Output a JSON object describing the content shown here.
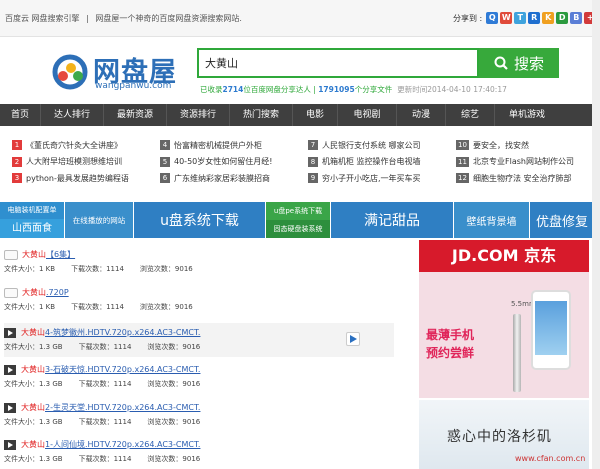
{
  "topbar": {
    "links": [
      "百度云 网盘搜索引擎",
      "|",
      "网盘屋一个神奇的百度网盘资源搜索网站."
    ],
    "share_label": "分享到 :"
  },
  "logo": {
    "cn": "网盘屋",
    "en": "wangpanwu.com"
  },
  "search": {
    "value": "大黄山",
    "button": "搜索"
  },
  "stats": {
    "prefix": "已收录",
    "users": "2714",
    "mid": "位百度网盘分享达人 |",
    "files": "1791095",
    "suffix": "个分享文件",
    "updated": "更新时间2014-04-10 17:40:17"
  },
  "nav": [
    "首页",
    "达人排行",
    "最新资源",
    "资源排行",
    "热门搜索",
    "电影",
    "电视剧",
    "动漫",
    "综艺",
    "单机游戏"
  ],
  "hot": [
    [
      {
        "n": "1",
        "t": "《董氏奇穴针灸大全讲座》"
      },
      {
        "n": "2",
        "t": "人大附早培班模测想维培训"
      },
      {
        "n": "3",
        "t": "python-最具发展趋势编程语"
      }
    ],
    [
      {
        "n": "4",
        "t": "怡富精密机械提供户外柜"
      },
      {
        "n": "5",
        "t": "40-50岁女性如何留住月经!"
      },
      {
        "n": "6",
        "t": "广东维纳彩家居彩装膜招商"
      }
    ],
    [
      {
        "n": "7",
        "t": "人民银行支付系统 哪家公司"
      },
      {
        "n": "8",
        "t": "机箱机柜 监控操作台电视墙"
      },
      {
        "n": "9",
        "t": "穷小子开小吃店,一年买车买"
      }
    ],
    [
      {
        "n": "10",
        "t": "要安全，找安然"
      },
      {
        "n": "11",
        "t": "北京专业Flash网站制作公司"
      },
      {
        "n": "12",
        "t": "细胞生物疗法 安全治疗肺部"
      }
    ]
  ],
  "banners": {
    "b1a": "电脑装机配置单",
    "b1b": "山西面食",
    "b2": "在线播放的网站",
    "b3": "u盘系统下载",
    "b4a": "u盘pe系统下载",
    "b4b": "固态硬盘装系统",
    "b5": "满记甜品",
    "b6": "壁纸背景墙",
    "b7": "优盘修复"
  },
  "results": [
    {
      "title": "大黄山",
      "rest": " 【6集】",
      "size": "文件大小：1 KB",
      "downloads": "下载次数：1114",
      "views": "浏览次数：9016",
      "type": "folder"
    },
    {
      "title": "大黄山",
      "rest": ".720P",
      "size": "文件大小：1 KB",
      "downloads": "下载次数：1114",
      "views": "浏览次数：9016",
      "type": "folder"
    },
    {
      "title": "大黄山",
      "rest": "4-筑梦徽州.HDTV.720p.x264.AC3-CMCT.",
      "size": "文件大小：1.3 GB",
      "downloads": "下载次数：1114",
      "views": "浏览次数：9016",
      "type": "video"
    },
    {
      "title": "大黄山",
      "rest": "3-石破天惊.HDTV.720p.x264.AC3-CMCT.",
      "size": "文件大小：1.3 GB",
      "downloads": "下载次数：1114",
      "views": "浏览次数：9016",
      "type": "video"
    },
    {
      "title": "大黄山",
      "rest": "2-生灵天堂.HDTV.720p.x264.AC3-CMCT.",
      "size": "文件大小：1.3 GB",
      "downloads": "下载次数：1114",
      "views": "浏览次数：9016",
      "type": "video"
    },
    {
      "title": "大黄山",
      "rest": "1-人间仙境.HDTV.720p.x264.AC3-CMCT.",
      "size": "文件大小：1.3 GB",
      "downloads": "下载次数：1114",
      "views": "浏览次数：9016",
      "type": "video"
    }
  ],
  "ad1": {
    "brand": "JD.COM 京东",
    "line1": "最薄手机",
    "line2": "预约尝鲜",
    "size": "5.5mm"
  },
  "ad2": {
    "text": "惑心中的洛杉矶",
    "watermark": "www.cfan.com.cn"
  },
  "colors": {
    "green": "#37a93b",
    "blue": "#2d6fb7",
    "nav": "#3f3f3f",
    "jd": "#d71a2b"
  }
}
